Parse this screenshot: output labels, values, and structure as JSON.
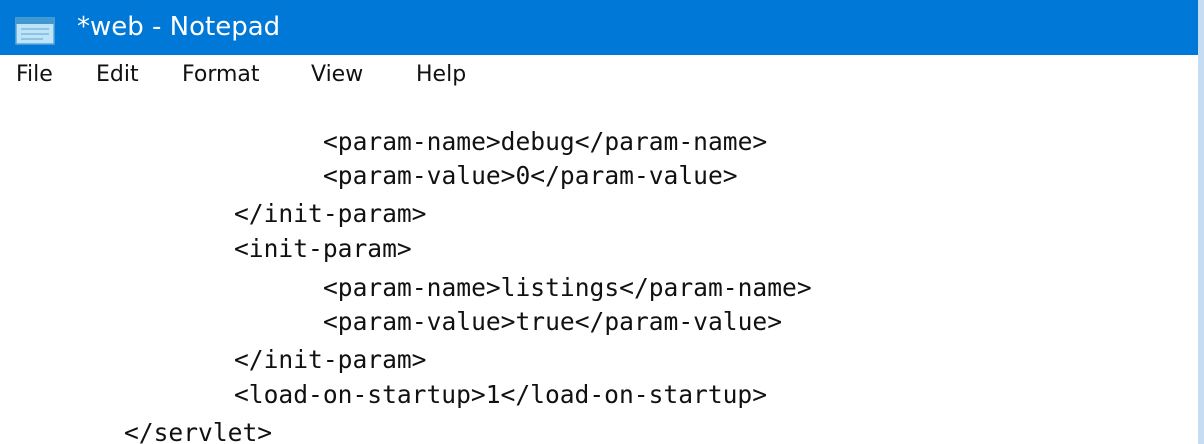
{
  "window": {
    "title": "*web - Notepad",
    "app_icon": "notepad-icon"
  },
  "menu": {
    "items": [
      "File",
      "Edit",
      "Format",
      "View",
      "Help"
    ]
  },
  "editor": {
    "lines": [
      "<param-name>debug</param-name>",
      "<param-value>0</param-value>",
      "</init-param>",
      "<init-param>",
      "<param-name>listings</param-name>",
      "<param-value>true</param-value>",
      "</init-param>",
      "<load-on-startup>1</load-on-startup>",
      "</servlet>"
    ]
  },
  "colors": {
    "titlebar": "#0078d7",
    "title_text": "#ffffff",
    "background": "#c6dcf2",
    "editor_background": "#ffffff",
    "text": "#111111"
  }
}
